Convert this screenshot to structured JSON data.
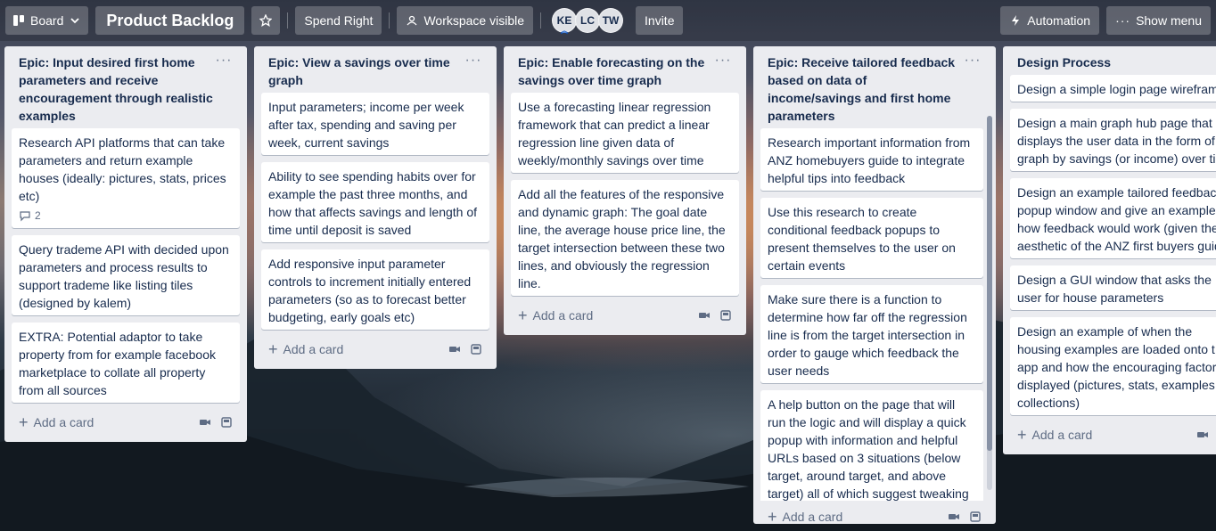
{
  "header": {
    "view_label": "Board",
    "board_title": "Product Backlog",
    "workspace_name": "Spend Right",
    "visibility_label": "Workspace visible",
    "members": [
      "KE",
      "LC",
      "TW"
    ],
    "invite_label": "Invite",
    "automation_label": "Automation",
    "show_menu_label": "Show menu"
  },
  "add_card_label": "Add a card",
  "lists": [
    {
      "title": "Epic: Input desired first home parameters and receive encouragement through realistic examples",
      "cards": [
        {
          "text": "Research API platforms that can take parameters and return example houses (ideally: pictures, stats, prices etc)",
          "comments": "2"
        },
        {
          "text": "Query trademe API with decided upon parameters and process results to support trademe like listing tiles (designed by kalem)"
        },
        {
          "text": "EXTRA: Potential adaptor to take property from for example facebook marketplace to collate all property from all sources"
        }
      ]
    },
    {
      "title": "Epic: View a savings over time graph",
      "cards": [
        {
          "text": "Input parameters; income per week after tax, spending and saving per week, current savings"
        },
        {
          "text": "Ability to see spending habits over for example the past three months, and how that affects savings and length of time until deposit is saved"
        },
        {
          "text": "Add responsive input parameter controls to increment initially entered parameters (so as to forecast better budgeting, early goals etc)"
        }
      ]
    },
    {
      "title": "Epic: Enable forecasting on the savings over time graph",
      "cards": [
        {
          "text": "Use a forecasting linear regression framework that can predict a linear regression line given data of weekly/monthly savings over time"
        },
        {
          "text": "Add all the features of the responsive and dynamic graph: The goal date line, the average house price line, the target intersection between these two lines, and obviously the regression line."
        }
      ]
    },
    {
      "title": "Epic: Receive tailored feedback based on data of income/savings and first home parameters",
      "cards": [
        {
          "text": "Research important information from ANZ homebuyers guide to integrate helpful tips into feedback"
        },
        {
          "text": "Use this research to create conditional feedback popups to present themselves to the user on certain events"
        },
        {
          "text": "Make sure there is a function to determine how far off the regression line is from the target intersection in order to gauge which feedback the user needs"
        },
        {
          "text": "A help button on the page that will run the logic and will display a quick popup with information and helpful URLs based on 3 situations (below target, around target, and above target) all of which suggest tweaking"
        }
      ]
    },
    {
      "title": "Design Process",
      "cards": [
        {
          "text": "Design a simple login page wirefram"
        },
        {
          "text": "Design a main graph hub page that displays the user data in the form of graph by savings (or income) over time"
        },
        {
          "text": "Design an example tailored feedback popup window and give an example of how feedback would work (given the aesthetic of the ANZ first buyers guide)"
        },
        {
          "text": "Design a GUI window that asks the user for house parameters"
        },
        {
          "text": "Design an example of when the housing examples are loaded onto t app and how the encouraging factor are displayed (pictures, stats, examples, collections)"
        }
      ]
    }
  ]
}
